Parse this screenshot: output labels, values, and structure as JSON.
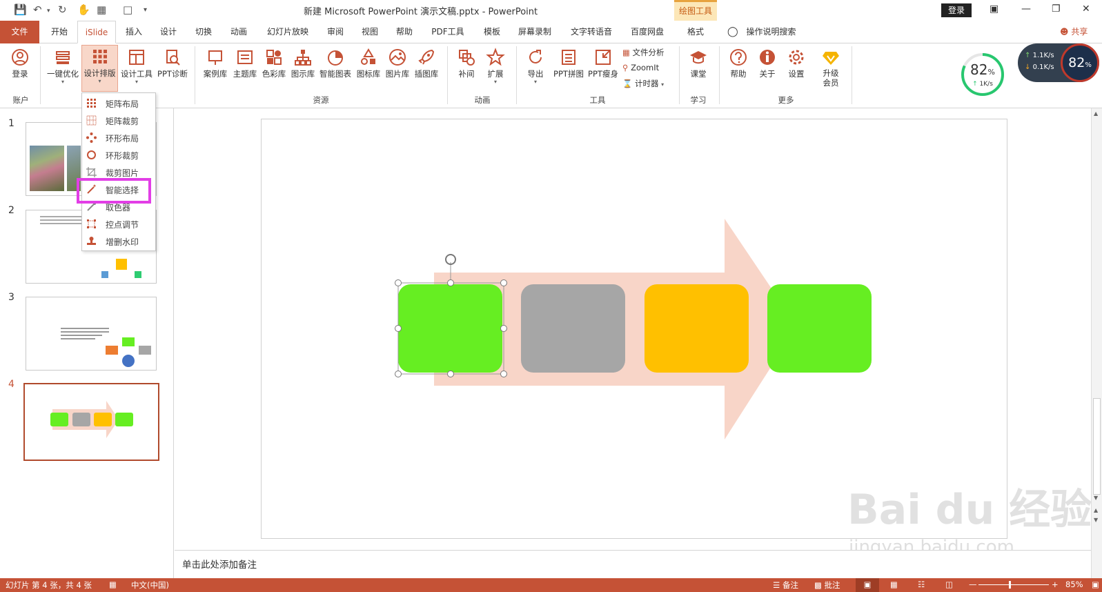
{
  "title": {
    "document": "新建 Microsoft PowerPoint 演示文稿.pptx  -  PowerPoint",
    "contextual_tab": "绘图工具",
    "login": "登录"
  },
  "tabs": [
    "文件",
    "开始",
    "iSlide",
    "插入",
    "设计",
    "切换",
    "动画",
    "幻灯片放映",
    "审阅",
    "视图",
    "帮助",
    "PDF工具",
    "模板",
    "屏幕录制",
    "文字转语音",
    "百度网盘",
    "格式"
  ],
  "tell_me": "操作说明搜索",
  "share": "共享",
  "ribbon": {
    "account": {
      "login": "登录",
      "label": "账户"
    },
    "design": {
      "one_click": "一键优化",
      "layout": "设计排版",
      "tools": "设计工具",
      "diagnose": "PPT诊断"
    },
    "resources": {
      "items": [
        "案例库",
        "主题库",
        "色彩库",
        "图示库",
        "智能图表",
        "图标库",
        "图片库",
        "插图库"
      ],
      "label": "资源"
    },
    "animation": {
      "items": [
        "补间",
        "扩展"
      ],
      "label": "动画"
    },
    "tools": {
      "items": [
        "导出",
        "PPT拼图",
        "PPT瘦身"
      ],
      "small": [
        "文件分析",
        "ZoomIt",
        "计时器"
      ],
      "label": "工具"
    },
    "learn": {
      "items": [
        "课堂"
      ],
      "label": "学习"
    },
    "more": {
      "items": [
        "帮助",
        "关于",
        "设置"
      ],
      "upgrade": "升级\n会员",
      "label": "更多"
    }
  },
  "speed": {
    "percent": "82",
    "unit": "%",
    "rate": "1K/s",
    "up": "1.1K/s",
    "down": "0.1K/s"
  },
  "dropdown": [
    "矩阵布局",
    "矩阵裁剪",
    "环形布局",
    "环形裁剪",
    "裁剪图片",
    "智能选择",
    "取色器",
    "控点调节",
    "增删水印"
  ],
  "slides": [
    "1",
    "2",
    "3",
    "4"
  ],
  "notes": "单击此处添加备注",
  "status": {
    "slide_info": "幻灯片 第 4 张，共 4 张",
    "language": "中文(中国)",
    "notes_btn": "备注",
    "comments_btn": "批注",
    "zoom": "85%"
  },
  "watermark": {
    "text": "Bai du 经验",
    "url": "jingyan.baidu.com"
  },
  "colors": {
    "accent": "#c55236",
    "green": "#66ee22",
    "gray": "#a6a6a6",
    "yellow": "#ffc000",
    "arrow": "#f8d5c8",
    "highlight": "#e23ee6"
  }
}
